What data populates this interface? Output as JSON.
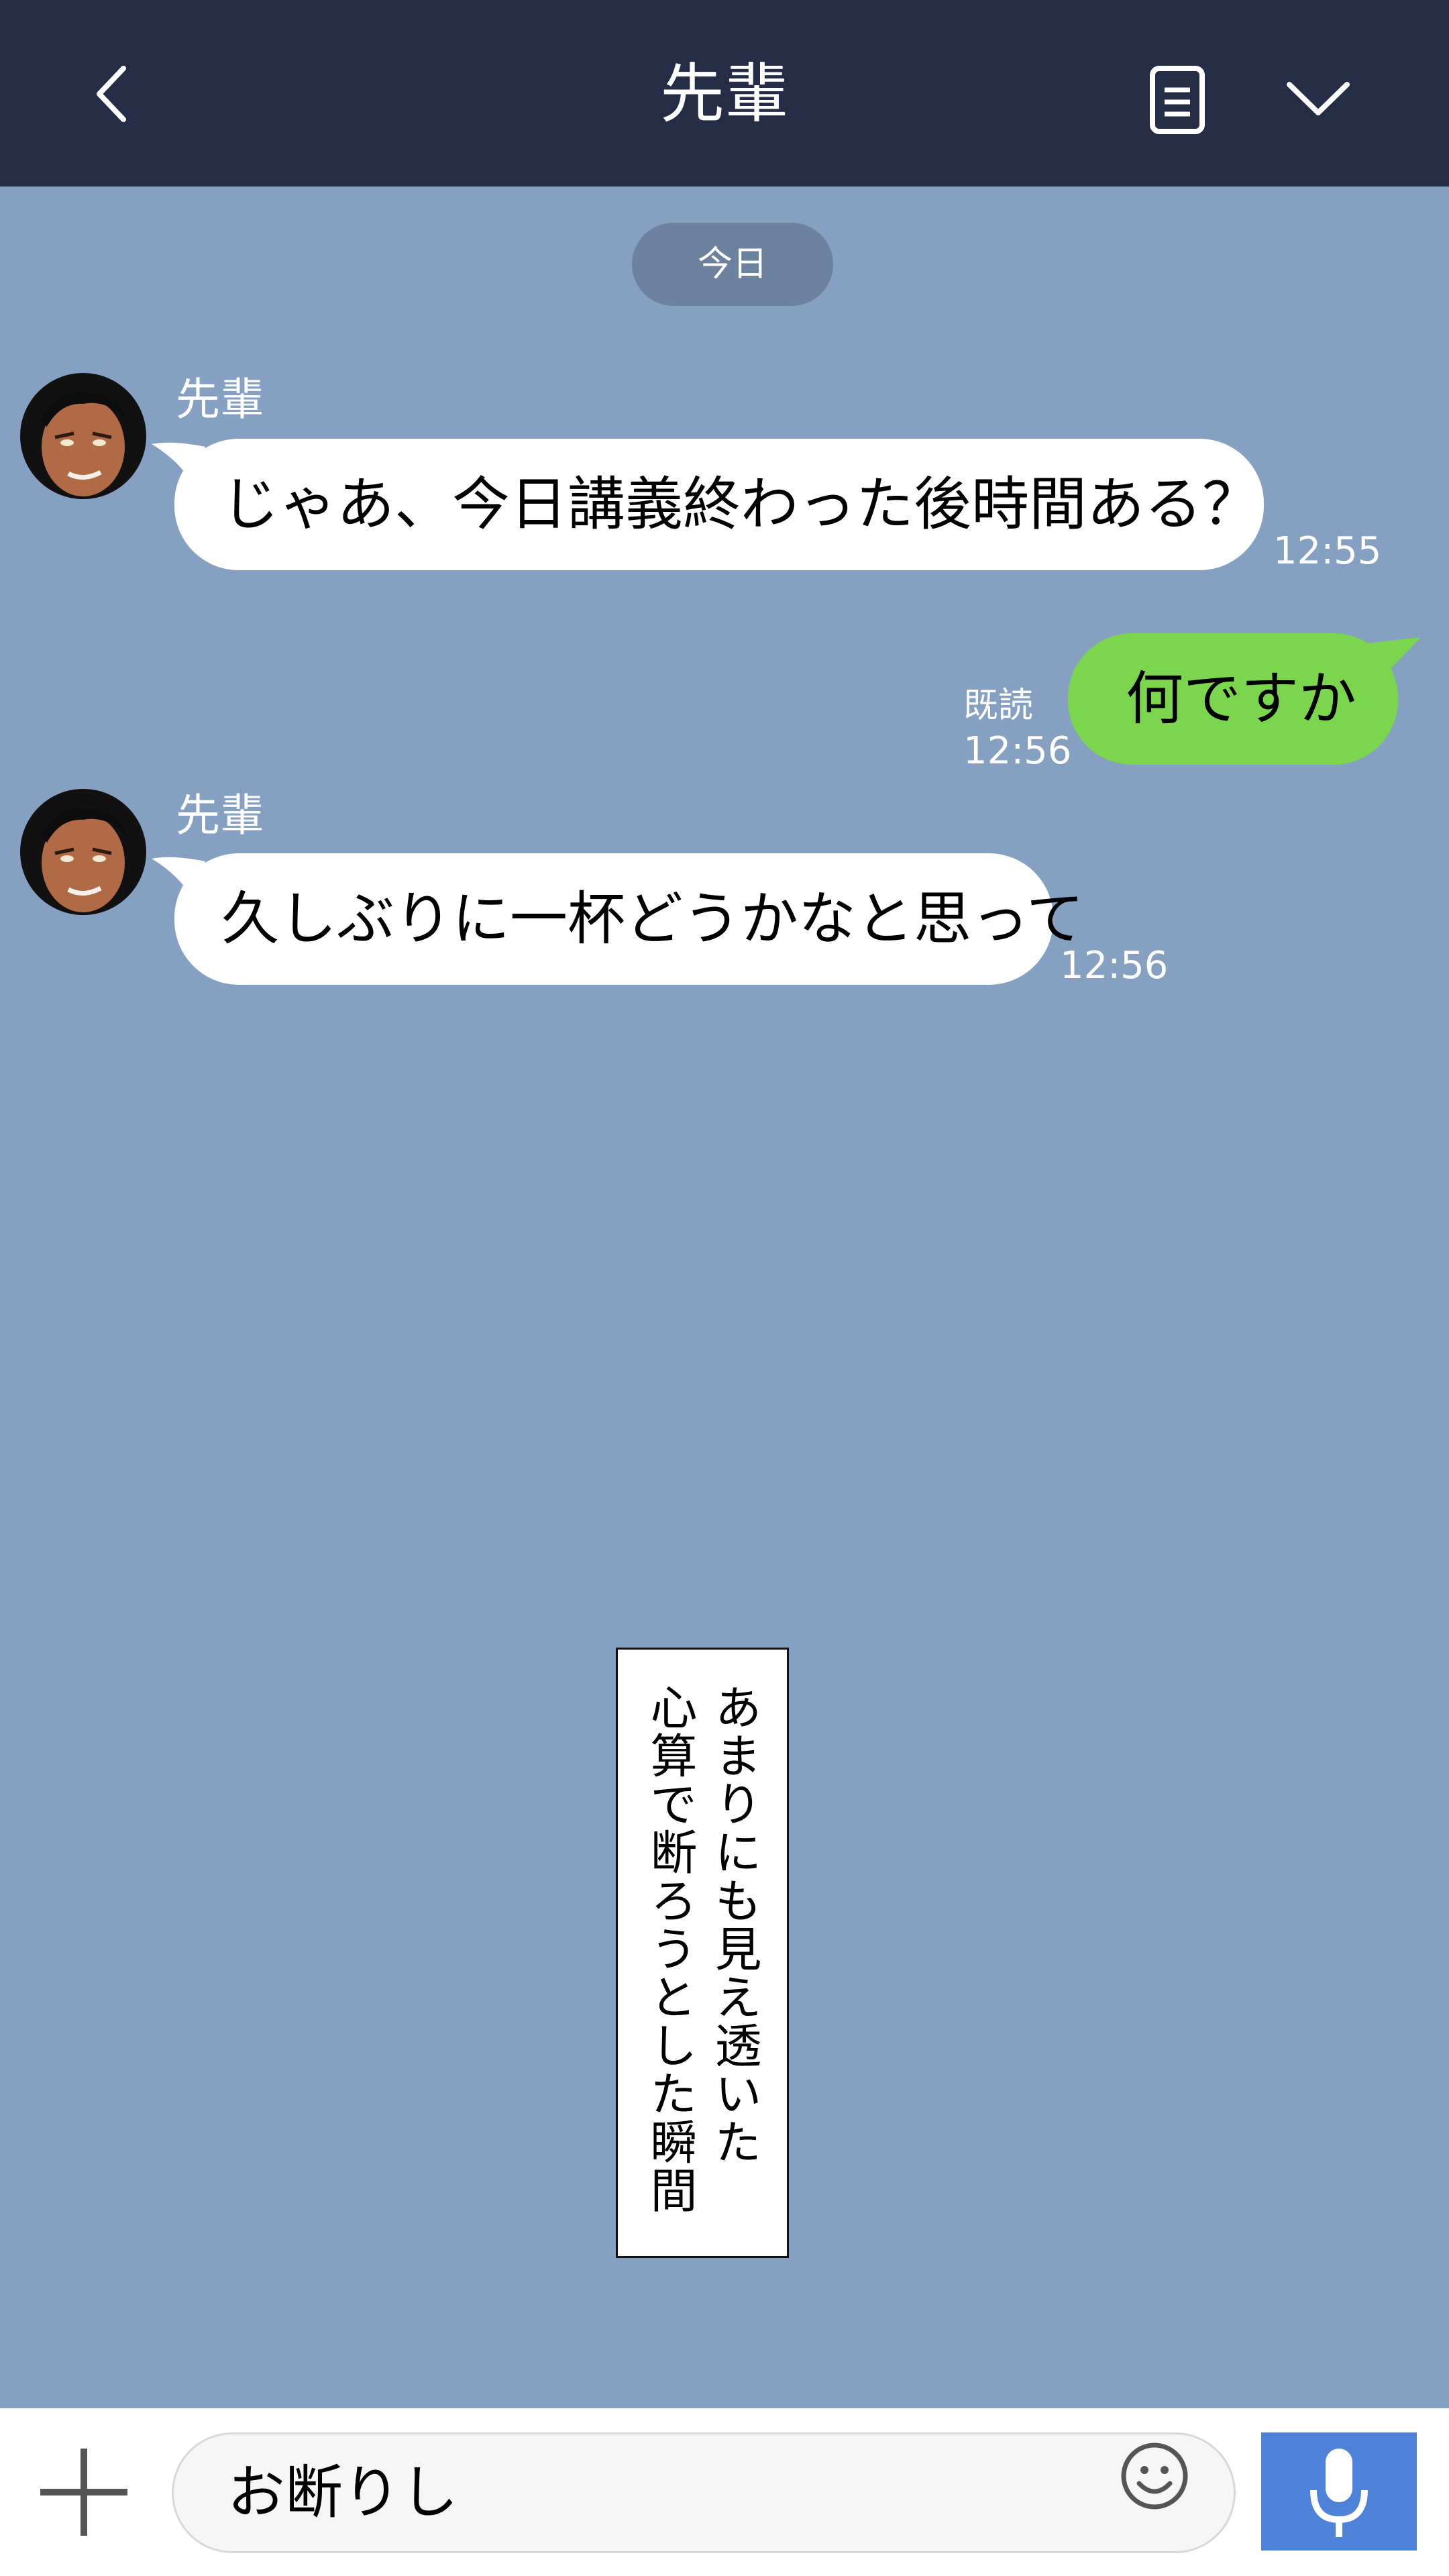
{
  "header": {
    "title": "先輩"
  },
  "date_divider": "今日",
  "messages": [
    {
      "sender": "先輩",
      "text": "じゃあ、今日講義終わった後時間ある？",
      "time": "12:55"
    },
    {
      "text": "何ですか",
      "read": "既読",
      "time": "12:56"
    },
    {
      "sender": "先輩",
      "text": "久しぶりに一杯どうかなと思って",
      "time": "12:56"
    }
  ],
  "narration": {
    "line1": "あまりにも見え透いた",
    "line2": "心算で断ろうとした瞬間"
  },
  "composer": {
    "input_value": "お断りし"
  },
  "colors": {
    "header_bg": "#252c46",
    "chat_bg": "#85a0c1",
    "my_bubble": "#7bd54d",
    "mic_button": "#4d82d8"
  },
  "icons": [
    "back-icon",
    "notes-icon",
    "chevron-down-icon",
    "plus-icon",
    "emoji-icon",
    "mic-icon"
  ]
}
